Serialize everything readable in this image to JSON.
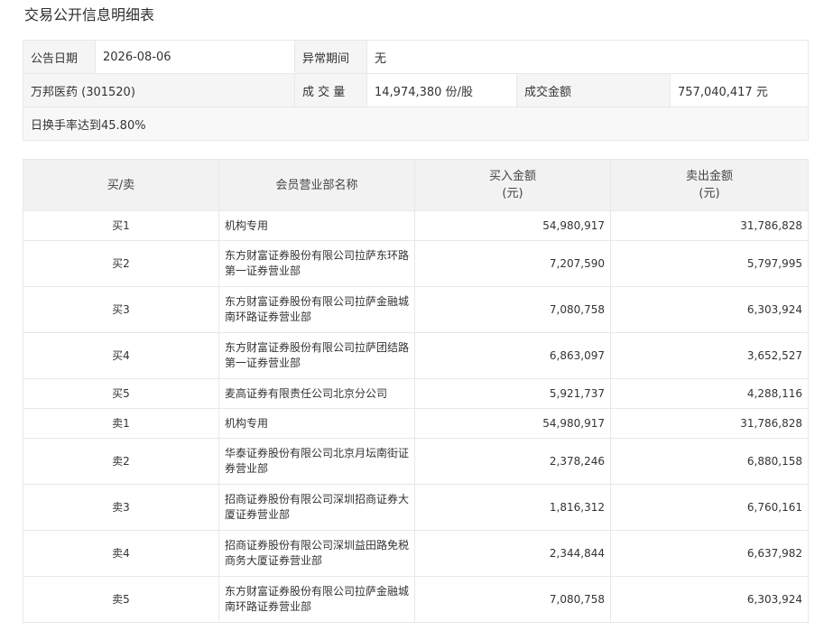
{
  "page": {
    "title": "交易公开信息明细表"
  },
  "info": {
    "announce_date_label": "公告日期",
    "announce_date": "2026-08-06",
    "abnormal_period_label": "异常期间",
    "abnormal_period": "无",
    "stock": "万邦医药 (301520)",
    "volume_label": "成 交 量",
    "volume": "14,974,380 份/股",
    "amount_label": "成交金额",
    "amount": "757,040,417 元",
    "reason": "日换手率达到45.80%"
  },
  "table": {
    "headers": {
      "side": "买/卖",
      "member": "会员营业部名称",
      "buy_amount": "买入金额",
      "buy_unit": "(元)",
      "sell_amount": "卖出金额",
      "sell_unit": "(元)"
    },
    "rows": [
      {
        "side": "买1",
        "line1": "机构专用",
        "line2": "",
        "buy": "54,980,917",
        "sell": "31,786,828"
      },
      {
        "side": "买2",
        "line1": "东方财富证券股份有限公司拉萨东环路",
        "line2": "第一证券营业部",
        "buy": "7,207,590",
        "sell": "5,797,995"
      },
      {
        "side": "买3",
        "line1": "东方财富证券股份有限公司拉萨金融城",
        "line2": "南环路证券营业部",
        "buy": "7,080,758",
        "sell": "6,303,924"
      },
      {
        "side": "买4",
        "line1": "东方财富证券股份有限公司拉萨团结路",
        "line2": "第一证券营业部",
        "buy": "6,863,097",
        "sell": "3,652,527"
      },
      {
        "side": "买5",
        "line1": "麦高证券有限责任公司北京分公司",
        "line2": "",
        "buy": "5,921,737",
        "sell": "4,288,116"
      },
      {
        "side": "卖1",
        "line1": "机构专用",
        "line2": "",
        "buy": "54,980,917",
        "sell": "31,786,828"
      },
      {
        "side": "卖2",
        "line1": "华泰证券股份有限公司北京月坛南街证",
        "line2": "券营业部",
        "buy": "2,378,246",
        "sell": "6,880,158"
      },
      {
        "side": "卖3",
        "line1": "招商证券股份有限公司深圳招商证券大",
        "line2": "厦证券营业部",
        "buy": "1,816,312",
        "sell": "6,760,161"
      },
      {
        "side": "卖4",
        "line1": "招商证券股份有限公司深圳益田路免税",
        "line2": "商务大厦证券营业部",
        "buy": "2,344,844",
        "sell": "6,637,982"
      },
      {
        "side": "卖5",
        "line1": "东方财富证券股份有限公司拉萨金融城",
        "line2": "南环路证券营业部",
        "buy": "7,080,758",
        "sell": "6,303,924"
      }
    ]
  }
}
